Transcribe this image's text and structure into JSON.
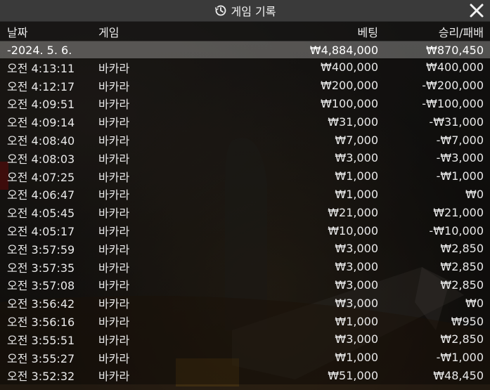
{
  "window": {
    "title": "게임 기록",
    "close_icon": "close-icon",
    "title_icon": "history-icon"
  },
  "columns": {
    "date": "날짜",
    "game": "게임",
    "bet": "베팅",
    "result": "승리/패배"
  },
  "date_group": {
    "label": "-2024. 5. 6.",
    "bet": "₩4,884,000",
    "result": "₩870,450"
  },
  "rows": [
    {
      "time": "오전 4:13:11",
      "game": "바카라",
      "bet": "₩400,000",
      "result": "₩400,000"
    },
    {
      "time": "오전 4:12:17",
      "game": "바카라",
      "bet": "₩200,000",
      "result": "-₩200,000"
    },
    {
      "time": "오전 4:09:51",
      "game": "바카라",
      "bet": "₩100,000",
      "result": "-₩100,000"
    },
    {
      "time": "오전 4:09:14",
      "game": "바카라",
      "bet": "₩31,000",
      "result": "-₩31,000"
    },
    {
      "time": "오전 4:08:40",
      "game": "바카라",
      "bet": "₩7,000",
      "result": "-₩7,000"
    },
    {
      "time": "오전 4:08:03",
      "game": "바카라",
      "bet": "₩3,000",
      "result": "-₩3,000"
    },
    {
      "time": "오전 4:07:25",
      "game": "바카라",
      "bet": "₩1,000",
      "result": "-₩1,000"
    },
    {
      "time": "오전 4:06:47",
      "game": "바카라",
      "bet": "₩1,000",
      "result": "₩0"
    },
    {
      "time": "오전 4:05:45",
      "game": "바카라",
      "bet": "₩21,000",
      "result": "₩21,000"
    },
    {
      "time": "오전 4:05:17",
      "game": "바카라",
      "bet": "₩10,000",
      "result": "-₩10,000"
    },
    {
      "time": "오전 3:57:59",
      "game": "바카라",
      "bet": "₩3,000",
      "result": "₩2,850"
    },
    {
      "time": "오전 3:57:35",
      "game": "바카라",
      "bet": "₩3,000",
      "result": "₩2,850"
    },
    {
      "time": "오전 3:57:08",
      "game": "바카라",
      "bet": "₩3,000",
      "result": "₩2,850"
    },
    {
      "time": "오전 3:56:42",
      "game": "바카라",
      "bet": "₩3,000",
      "result": "₩0"
    },
    {
      "time": "오전 3:56:16",
      "game": "바카라",
      "bet": "₩1,000",
      "result": "₩950"
    },
    {
      "time": "오전 3:55:51",
      "game": "바카라",
      "bet": "₩3,000",
      "result": "₩2,850"
    },
    {
      "time": "오전 3:55:27",
      "game": "바카라",
      "bet": "₩1,000",
      "result": "-₩1,000"
    },
    {
      "time": "오전 3:52:32",
      "game": "바카라",
      "bet": "₩51,000",
      "result": "₩48,450"
    }
  ]
}
